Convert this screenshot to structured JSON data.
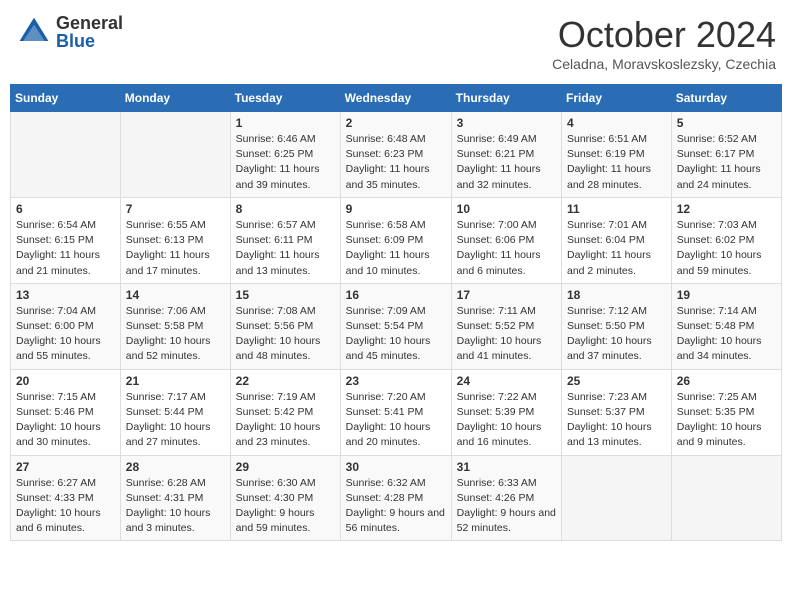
{
  "header": {
    "logo": {
      "general": "General",
      "blue": "Blue"
    },
    "title": "October 2024",
    "subtitle": "Celadna, Moravskoslezsky, Czechia"
  },
  "weekdays": [
    "Sunday",
    "Monday",
    "Tuesday",
    "Wednesday",
    "Thursday",
    "Friday",
    "Saturday"
  ],
  "weeks": [
    [
      {
        "day": "",
        "info": ""
      },
      {
        "day": "",
        "info": ""
      },
      {
        "day": "1",
        "info": "Sunrise: 6:46 AM\nSunset: 6:25 PM\nDaylight: 11 hours and 39 minutes."
      },
      {
        "day": "2",
        "info": "Sunrise: 6:48 AM\nSunset: 6:23 PM\nDaylight: 11 hours and 35 minutes."
      },
      {
        "day": "3",
        "info": "Sunrise: 6:49 AM\nSunset: 6:21 PM\nDaylight: 11 hours and 32 minutes."
      },
      {
        "day": "4",
        "info": "Sunrise: 6:51 AM\nSunset: 6:19 PM\nDaylight: 11 hours and 28 minutes."
      },
      {
        "day": "5",
        "info": "Sunrise: 6:52 AM\nSunset: 6:17 PM\nDaylight: 11 hours and 24 minutes."
      }
    ],
    [
      {
        "day": "6",
        "info": "Sunrise: 6:54 AM\nSunset: 6:15 PM\nDaylight: 11 hours and 21 minutes."
      },
      {
        "day": "7",
        "info": "Sunrise: 6:55 AM\nSunset: 6:13 PM\nDaylight: 11 hours and 17 minutes."
      },
      {
        "day": "8",
        "info": "Sunrise: 6:57 AM\nSunset: 6:11 PM\nDaylight: 11 hours and 13 minutes."
      },
      {
        "day": "9",
        "info": "Sunrise: 6:58 AM\nSunset: 6:09 PM\nDaylight: 11 hours and 10 minutes."
      },
      {
        "day": "10",
        "info": "Sunrise: 7:00 AM\nSunset: 6:06 PM\nDaylight: 11 hours and 6 minutes."
      },
      {
        "day": "11",
        "info": "Sunrise: 7:01 AM\nSunset: 6:04 PM\nDaylight: 11 hours and 2 minutes."
      },
      {
        "day": "12",
        "info": "Sunrise: 7:03 AM\nSunset: 6:02 PM\nDaylight: 10 hours and 59 minutes."
      }
    ],
    [
      {
        "day": "13",
        "info": "Sunrise: 7:04 AM\nSunset: 6:00 PM\nDaylight: 10 hours and 55 minutes."
      },
      {
        "day": "14",
        "info": "Sunrise: 7:06 AM\nSunset: 5:58 PM\nDaylight: 10 hours and 52 minutes."
      },
      {
        "day": "15",
        "info": "Sunrise: 7:08 AM\nSunset: 5:56 PM\nDaylight: 10 hours and 48 minutes."
      },
      {
        "day": "16",
        "info": "Sunrise: 7:09 AM\nSunset: 5:54 PM\nDaylight: 10 hours and 45 minutes."
      },
      {
        "day": "17",
        "info": "Sunrise: 7:11 AM\nSunset: 5:52 PM\nDaylight: 10 hours and 41 minutes."
      },
      {
        "day": "18",
        "info": "Sunrise: 7:12 AM\nSunset: 5:50 PM\nDaylight: 10 hours and 37 minutes."
      },
      {
        "day": "19",
        "info": "Sunrise: 7:14 AM\nSunset: 5:48 PM\nDaylight: 10 hours and 34 minutes."
      }
    ],
    [
      {
        "day": "20",
        "info": "Sunrise: 7:15 AM\nSunset: 5:46 PM\nDaylight: 10 hours and 30 minutes."
      },
      {
        "day": "21",
        "info": "Sunrise: 7:17 AM\nSunset: 5:44 PM\nDaylight: 10 hours and 27 minutes."
      },
      {
        "day": "22",
        "info": "Sunrise: 7:19 AM\nSunset: 5:42 PM\nDaylight: 10 hours and 23 minutes."
      },
      {
        "day": "23",
        "info": "Sunrise: 7:20 AM\nSunset: 5:41 PM\nDaylight: 10 hours and 20 minutes."
      },
      {
        "day": "24",
        "info": "Sunrise: 7:22 AM\nSunset: 5:39 PM\nDaylight: 10 hours and 16 minutes."
      },
      {
        "day": "25",
        "info": "Sunrise: 7:23 AM\nSunset: 5:37 PM\nDaylight: 10 hours and 13 minutes."
      },
      {
        "day": "26",
        "info": "Sunrise: 7:25 AM\nSunset: 5:35 PM\nDaylight: 10 hours and 9 minutes."
      }
    ],
    [
      {
        "day": "27",
        "info": "Sunrise: 6:27 AM\nSunset: 4:33 PM\nDaylight: 10 hours and 6 minutes."
      },
      {
        "day": "28",
        "info": "Sunrise: 6:28 AM\nSunset: 4:31 PM\nDaylight: 10 hours and 3 minutes."
      },
      {
        "day": "29",
        "info": "Sunrise: 6:30 AM\nSunset: 4:30 PM\nDaylight: 9 hours and 59 minutes."
      },
      {
        "day": "30",
        "info": "Sunrise: 6:32 AM\nSunset: 4:28 PM\nDaylight: 9 hours and 56 minutes."
      },
      {
        "day": "31",
        "info": "Sunrise: 6:33 AM\nSunset: 4:26 PM\nDaylight: 9 hours and 52 minutes."
      },
      {
        "day": "",
        "info": ""
      },
      {
        "day": "",
        "info": ""
      }
    ]
  ]
}
